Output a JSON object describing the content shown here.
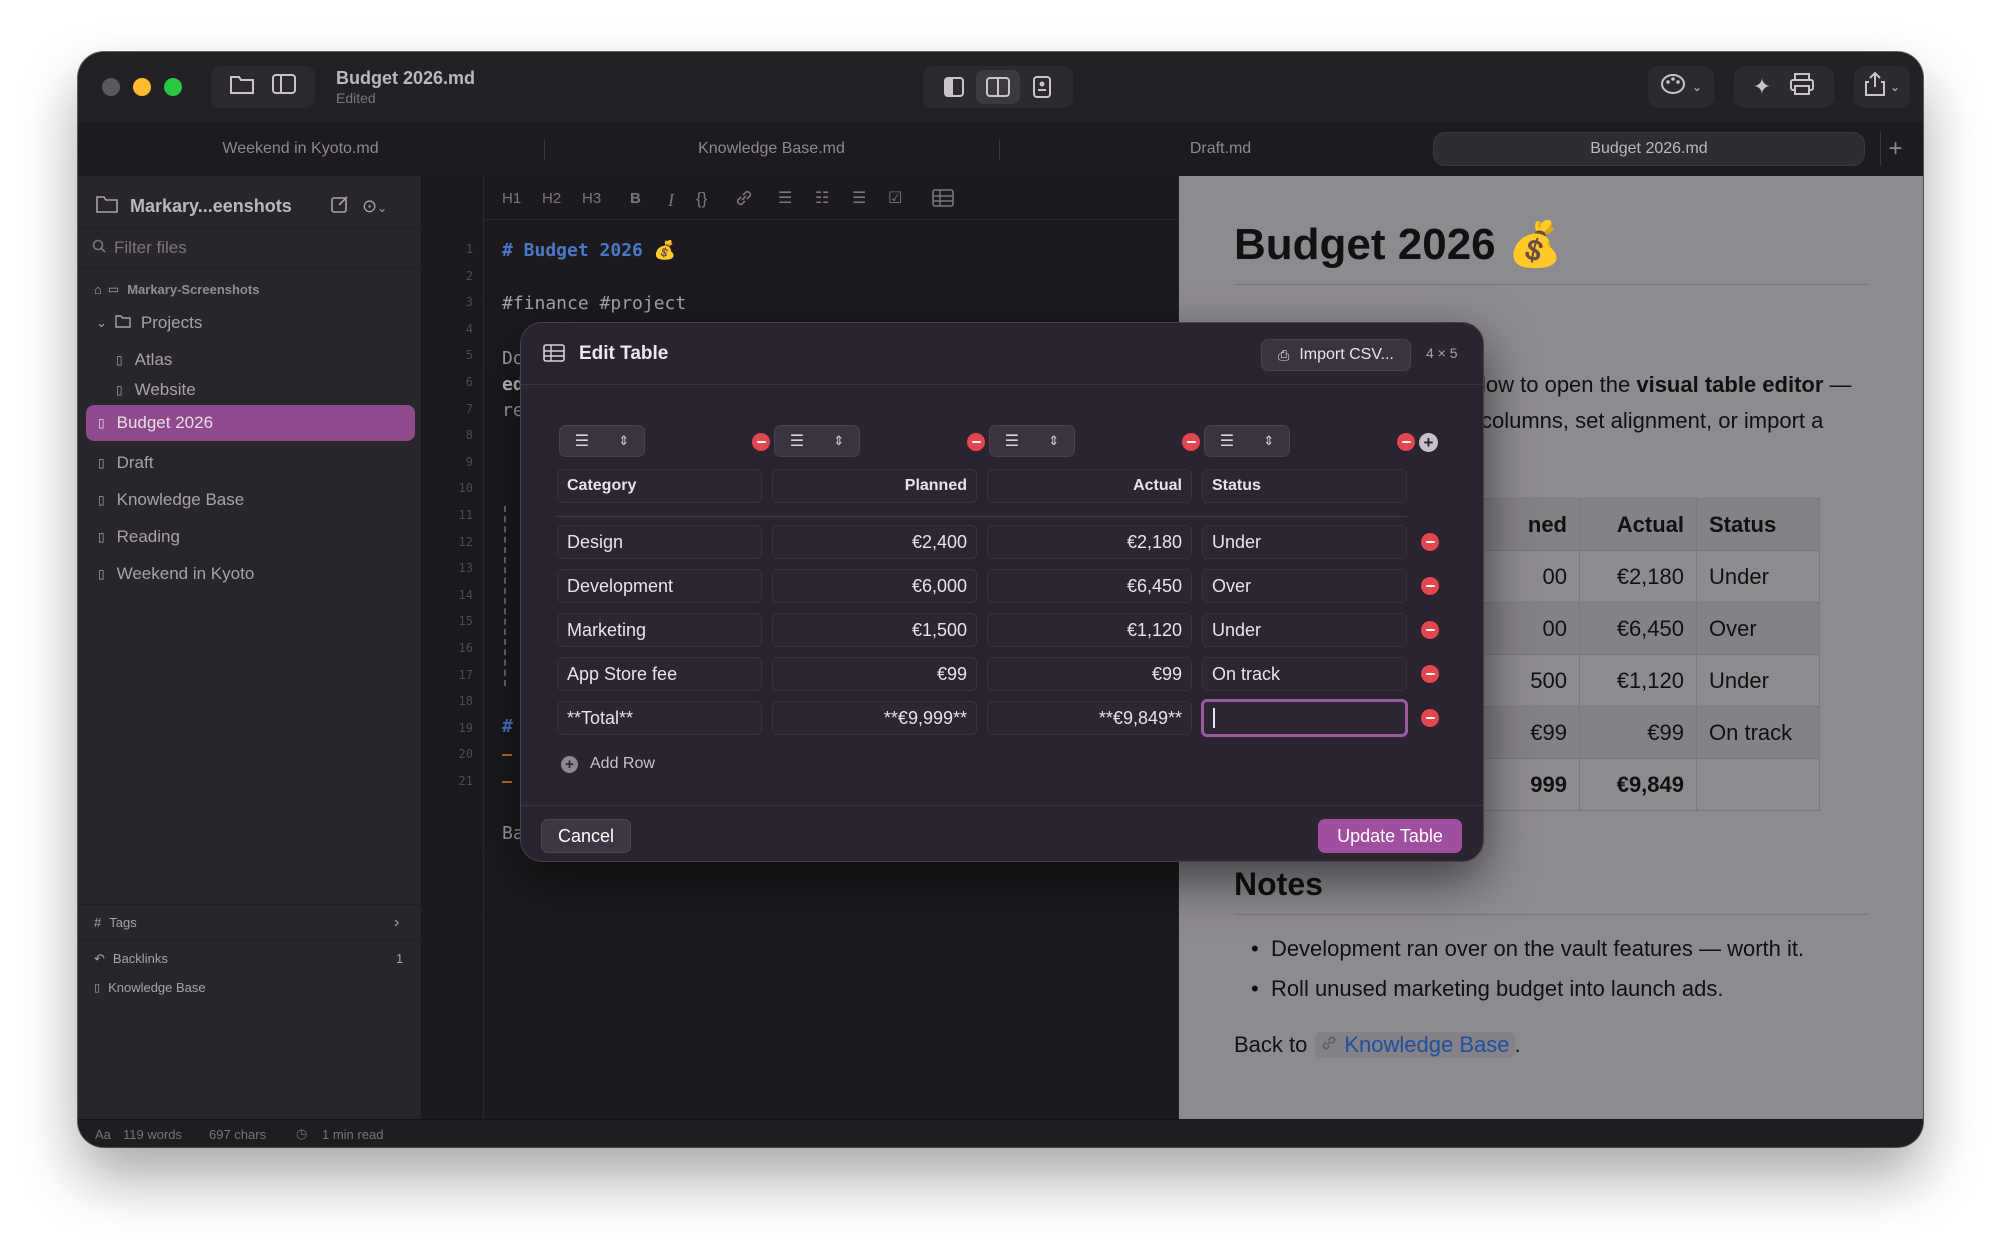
{
  "window": {
    "title": "Budget 2026.md",
    "subtitle": "Edited",
    "colors": {
      "accent": "#8e4a8c",
      "close": "#ff5f57",
      "minimize": "#febc2e",
      "zoom": "#28c840",
      "danger": "#e2474f"
    }
  },
  "tabs": [
    {
      "label": "Weekend in Kyoto.md",
      "active": false
    },
    {
      "label": "Knowledge Base.md",
      "active": false
    },
    {
      "label": "Draft.md",
      "active": false
    },
    {
      "label": "Budget 2026.md",
      "active": true
    }
  ],
  "sidebar": {
    "vault_name": "Markary...eenshots",
    "filter_placeholder": "Filter files",
    "root": "Markary-Screenshots",
    "folder": "Projects",
    "items": [
      "Atlas",
      "Website",
      "Budget 2026",
      "Draft",
      "Knowledge Base",
      "Reading",
      "Weekend in Kyoto"
    ],
    "selected": "Budget 2026",
    "tags_label": "Tags",
    "backlinks_label": "Backlinks",
    "backlinks_count": "1",
    "backlink_item": "Knowledge Base"
  },
  "toolbar": {
    "h1": "H1",
    "h2": "H2",
    "h3": "H3",
    "bold": "B",
    "italic": "I",
    "code": "{}"
  },
  "editor": {
    "line_numbers": [
      "1",
      "2",
      "3",
      "4",
      "5",
      "6",
      "7",
      "8",
      "9",
      "10",
      "11",
      "12",
      "13",
      "14",
      "15",
      "16",
      "17",
      "18",
      "19",
      "20",
      "21"
    ],
    "line1": "# Budget 2026 💰",
    "line3": "#finance #project",
    "line5": "Do",
    "line5b": "ed",
    "line6": "re",
    "line16": "#",
    "line20": "Ba"
  },
  "preview": {
    "title": "Budget 2026 💰",
    "para_a": "low to open the ",
    "para_b": "visual table editor",
    "para_c": " —",
    "para_line2": "columns, set alignment, or import a",
    "table_headers": [
      "ned",
      "Actual",
      "Status"
    ],
    "table_rows": [
      [
        "00",
        "€2,180",
        "Under"
      ],
      [
        "00",
        "€6,450",
        "Over"
      ],
      [
        "500",
        "€1,120",
        "Under"
      ],
      [
        "€99",
        "€99",
        "On track"
      ],
      [
        "999",
        "€9,849",
        ""
      ]
    ],
    "notes_heading": "Notes",
    "bullets": [
      "Development ran over on the vault features — worth it.",
      "Roll unused marketing budget into launch ads."
    ],
    "back_to": "Back to",
    "link_text": "Knowledge Base",
    "period": "."
  },
  "modal": {
    "title": "Edit Table",
    "import_label": "Import CSV...",
    "size_label": "4 × 5",
    "headers": [
      "Category",
      "Planned",
      "Actual",
      "Status"
    ],
    "rows": [
      [
        "Design",
        "€2,400",
        "€2,180",
        "Under"
      ],
      [
        "Development",
        "€6,000",
        "€6,450",
        "Over"
      ],
      [
        "Marketing",
        "€1,500",
        "€1,120",
        "Under"
      ],
      [
        "App Store fee",
        "€99",
        "€99",
        "On track"
      ],
      [
        "**Total**",
        "**€9,999**",
        "**€9,849**",
        ""
      ]
    ],
    "add_row_label": "Add Row",
    "cancel_label": "Cancel",
    "update_label": "Update Table"
  },
  "statusbar": {
    "font_icon": "Aa",
    "words": "119 words",
    "chars": "697 chars",
    "read_time": "1 min read"
  }
}
